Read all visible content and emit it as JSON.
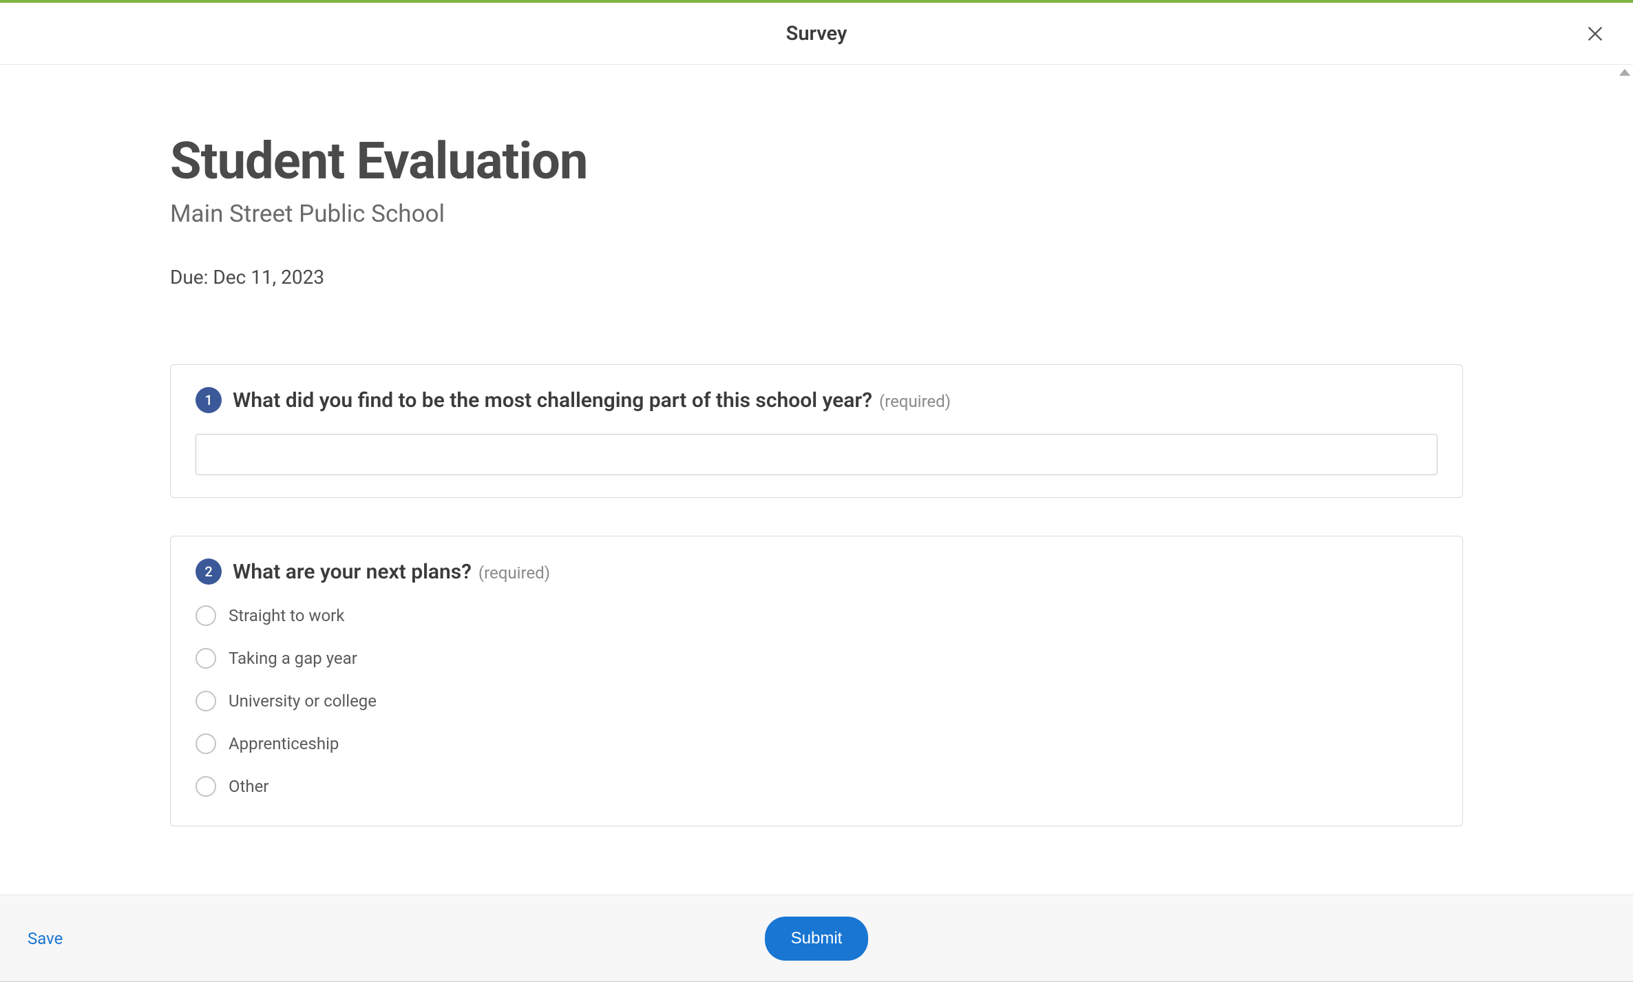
{
  "header": {
    "title": "Survey"
  },
  "page": {
    "title": "Student Evaluation",
    "subtitle": "Main Street Public School",
    "due": "Due: Dec 11, 2023"
  },
  "questions": [
    {
      "number": "1",
      "text": "What did you find to be the most challenging part of this school year?",
      "required": "(required)",
      "value": ""
    },
    {
      "number": "2",
      "text": "What are your next plans?",
      "required": "(required)",
      "options": [
        "Straight to work",
        "Taking a gap year",
        "University or college",
        "Apprenticeship",
        "Other"
      ]
    }
  ],
  "footer": {
    "save": "Save",
    "submit": "Submit"
  }
}
